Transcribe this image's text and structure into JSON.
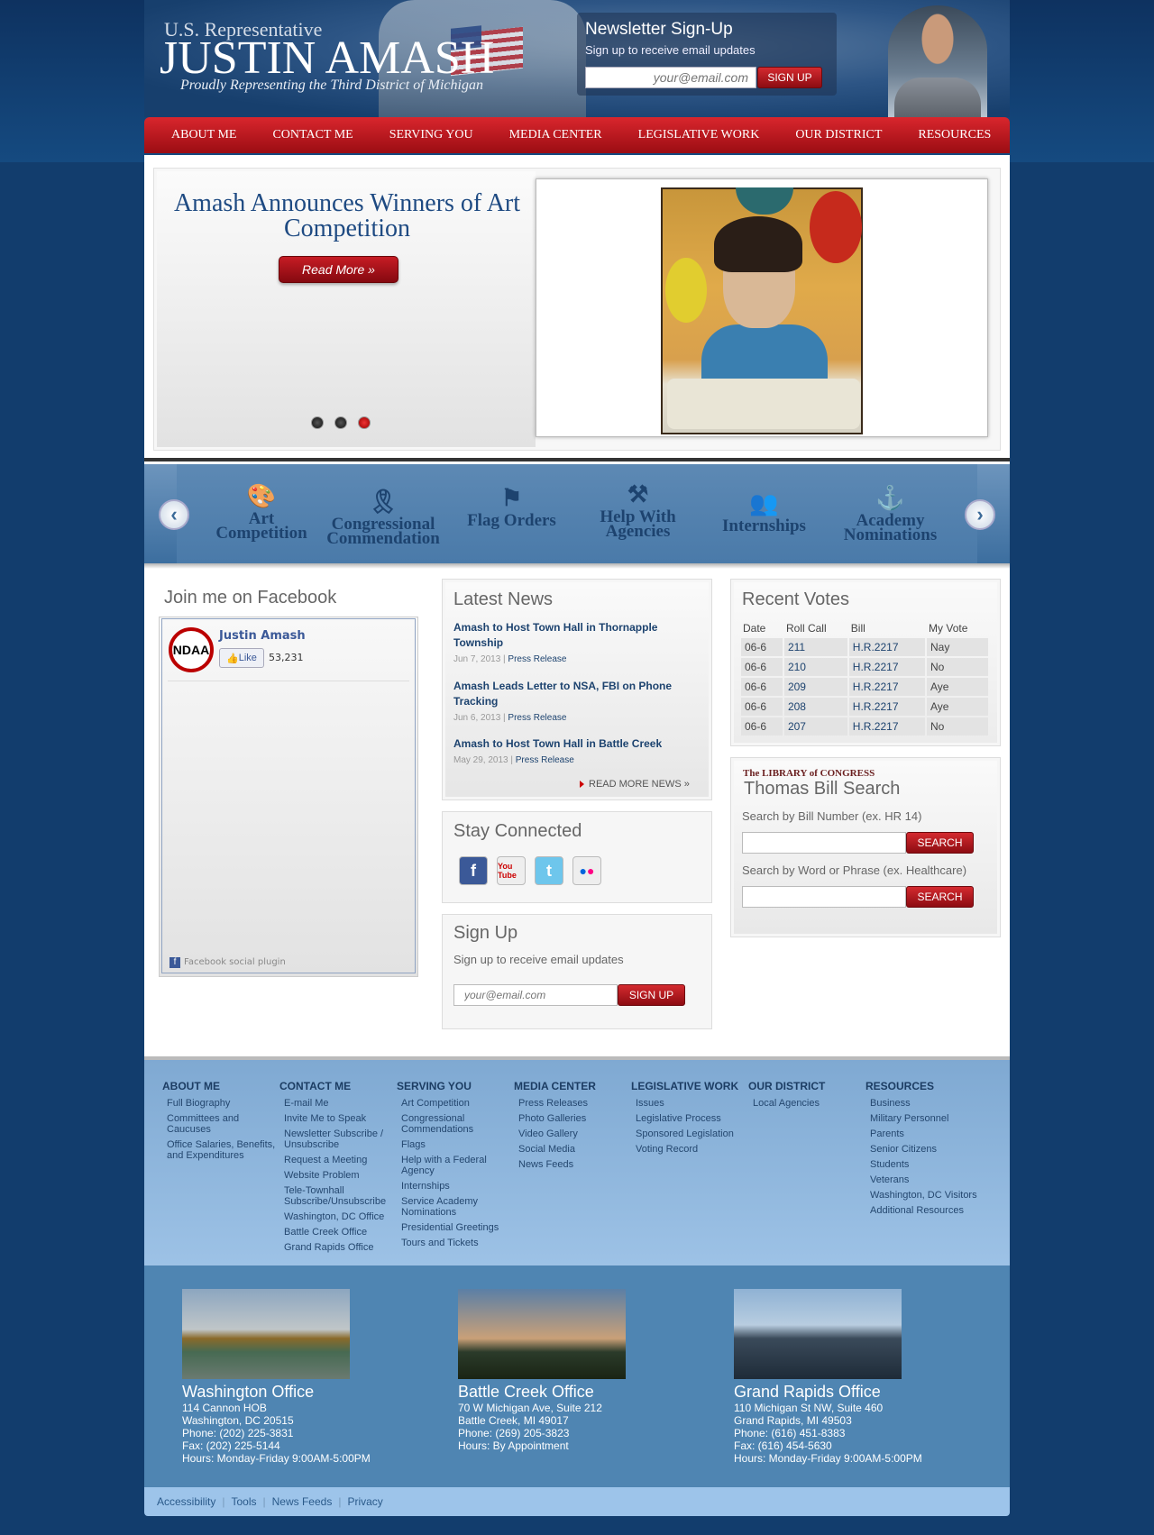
{
  "header": {
    "rep_title": "U.S. Representative",
    "rep_name": "JUSTIN AMASH",
    "tagline": "Proudly Representing the Third District of Michigan",
    "newsletter": {
      "title": "Newsletter Sign-Up",
      "subtitle": "Sign up to receive email updates",
      "placeholder": "your@email.com",
      "button": "SIGN UP"
    }
  },
  "nav": [
    "ABOUT ME",
    "CONTACT ME",
    "SERVING YOU",
    "MEDIA CENTER",
    "LEGISLATIVE WORK",
    "OUR DISTRICT",
    "RESOURCES"
  ],
  "slider": {
    "title": "Amash Announces Winners of Art Competition",
    "read_more": "Read More »",
    "dots": 3,
    "active_dot": 3
  },
  "iconbar": {
    "items": [
      {
        "label": "Art Competition",
        "icon": "palette-icon"
      },
      {
        "label": "Congressional Commendation",
        "icon": "ribbon-icon"
      },
      {
        "label": "Flag Orders",
        "icon": "flag-icon"
      },
      {
        "label": "Help With Agencies",
        "icon": "gavel-icon"
      },
      {
        "label": "Internships",
        "icon": "people-icon"
      },
      {
        "label": "Academy Nominations",
        "icon": "anchor-icon"
      }
    ]
  },
  "facebook": {
    "title": "Join me on Facebook",
    "logo_text": "NDAA",
    "name": "Justin Amash",
    "like": "Like",
    "count": "53,231",
    "plugin": "Facebook social plugin"
  },
  "news": {
    "title": "Latest News",
    "items": [
      {
        "headline": "Amash to Host Town Hall in Thornapple Township",
        "date": "Jun 7, 2013",
        "type": "Press Release"
      },
      {
        "headline": "Amash Leads Letter to NSA, FBI on Phone Tracking",
        "date": "Jun 6, 2013",
        "type": "Press Release"
      },
      {
        "headline": "Amash to Host Town Hall in Battle Creek",
        "date": "May 29, 2013",
        "type": "Press Release"
      }
    ],
    "more": "READ MORE NEWS »"
  },
  "stay": {
    "title": "Stay Connected",
    "icons": [
      "facebook-icon",
      "youtube-icon",
      "twitter-icon",
      "flickr-icon"
    ],
    "yt_text": "You Tube"
  },
  "signup": {
    "title": "Sign Up",
    "subtitle": "Sign up to receive email updates",
    "placeholder": "your@email.com",
    "button": "SIGN UP"
  },
  "votes": {
    "title": "Recent Votes",
    "headers": [
      "Date",
      "Roll Call",
      "Bill",
      "My Vote"
    ],
    "rows": [
      [
        "06-6",
        "211",
        "H.R.2217",
        "Nay"
      ],
      [
        "06-6",
        "210",
        "H.R.2217",
        "No"
      ],
      [
        "06-6",
        "209",
        "H.R.2217",
        "Aye"
      ],
      [
        "06-6",
        "208",
        "H.R.2217",
        "Aye"
      ],
      [
        "06-6",
        "207",
        "H.R.2217",
        "No"
      ]
    ]
  },
  "thomas": {
    "loc": "The LIBRARY of CONGRESS",
    "title": "Thomas Bill Search",
    "label1": "Search by Bill Number  (ex. HR 14)",
    "label2": "Search by Word or Phrase  (ex. Healthcare)",
    "button": "SEARCH"
  },
  "footer_nav": [
    {
      "heading": "ABOUT ME",
      "links": [
        "Full Biography",
        "Committees and Caucuses",
        "Office Salaries, Benefits, and Expenditures"
      ]
    },
    {
      "heading": "CONTACT ME",
      "links": [
        "E-mail Me",
        "Invite Me to Speak",
        "Newsletter Subscribe / Unsubscribe",
        "Request a Meeting",
        "Website Problem",
        "Tele-Townhall Subscribe/Unsubscribe",
        "Washington, DC Office",
        "Battle Creek Office",
        "Grand Rapids Office"
      ]
    },
    {
      "heading": "SERVING YOU",
      "links": [
        "Art Competition",
        "Congressional Commendations",
        "Flags",
        "Help with a Federal Agency",
        "Internships",
        "Service Academy Nominations",
        "Presidential Greetings",
        "Tours and Tickets"
      ]
    },
    {
      "heading": "MEDIA CENTER",
      "links": [
        "Press Releases",
        "Photo Galleries",
        "Video Gallery",
        "Social Media",
        "News Feeds"
      ]
    },
    {
      "heading": "LEGISLATIVE WORK",
      "links": [
        "Issues",
        "Legislative Process",
        "Sponsored Legislation",
        "Voting Record"
      ]
    },
    {
      "heading": "OUR DISTRICT",
      "links": [
        "Local Agencies"
      ]
    },
    {
      "heading": "RESOURCES",
      "links": [
        "Business",
        "Military Personnel",
        "Parents",
        "Senior Citizens",
        "Students",
        "Veterans",
        "Washington, DC Visitors",
        "Additional Resources"
      ]
    }
  ],
  "offices": [
    {
      "name": "Washington Office",
      "lines": [
        "114 Cannon HOB",
        "Washington, DC 20515",
        "Phone: (202) 225-3831",
        "Fax: (202) 225-5144",
        "Hours: Monday-Friday 9:00AM-5:00PM"
      ]
    },
    {
      "name": "Battle Creek Office",
      "lines": [
        "70 W Michigan Ave, Suite 212",
        "Battle Creek, MI 49017",
        "Phone: (269) 205-3823",
        "Hours: By Appointment"
      ]
    },
    {
      "name": "Grand Rapids Office",
      "lines": [
        "110 Michigan St NW, Suite 460",
        "Grand Rapids, MI 49503",
        "Phone: (616) 451-8383",
        "Fax: (616) 454-5630",
        "Hours: Monday-Friday 9:00AM-5:00PM"
      ]
    }
  ],
  "bottom_links": [
    "Accessibility",
    "Tools",
    "News Feeds",
    "Privacy"
  ]
}
